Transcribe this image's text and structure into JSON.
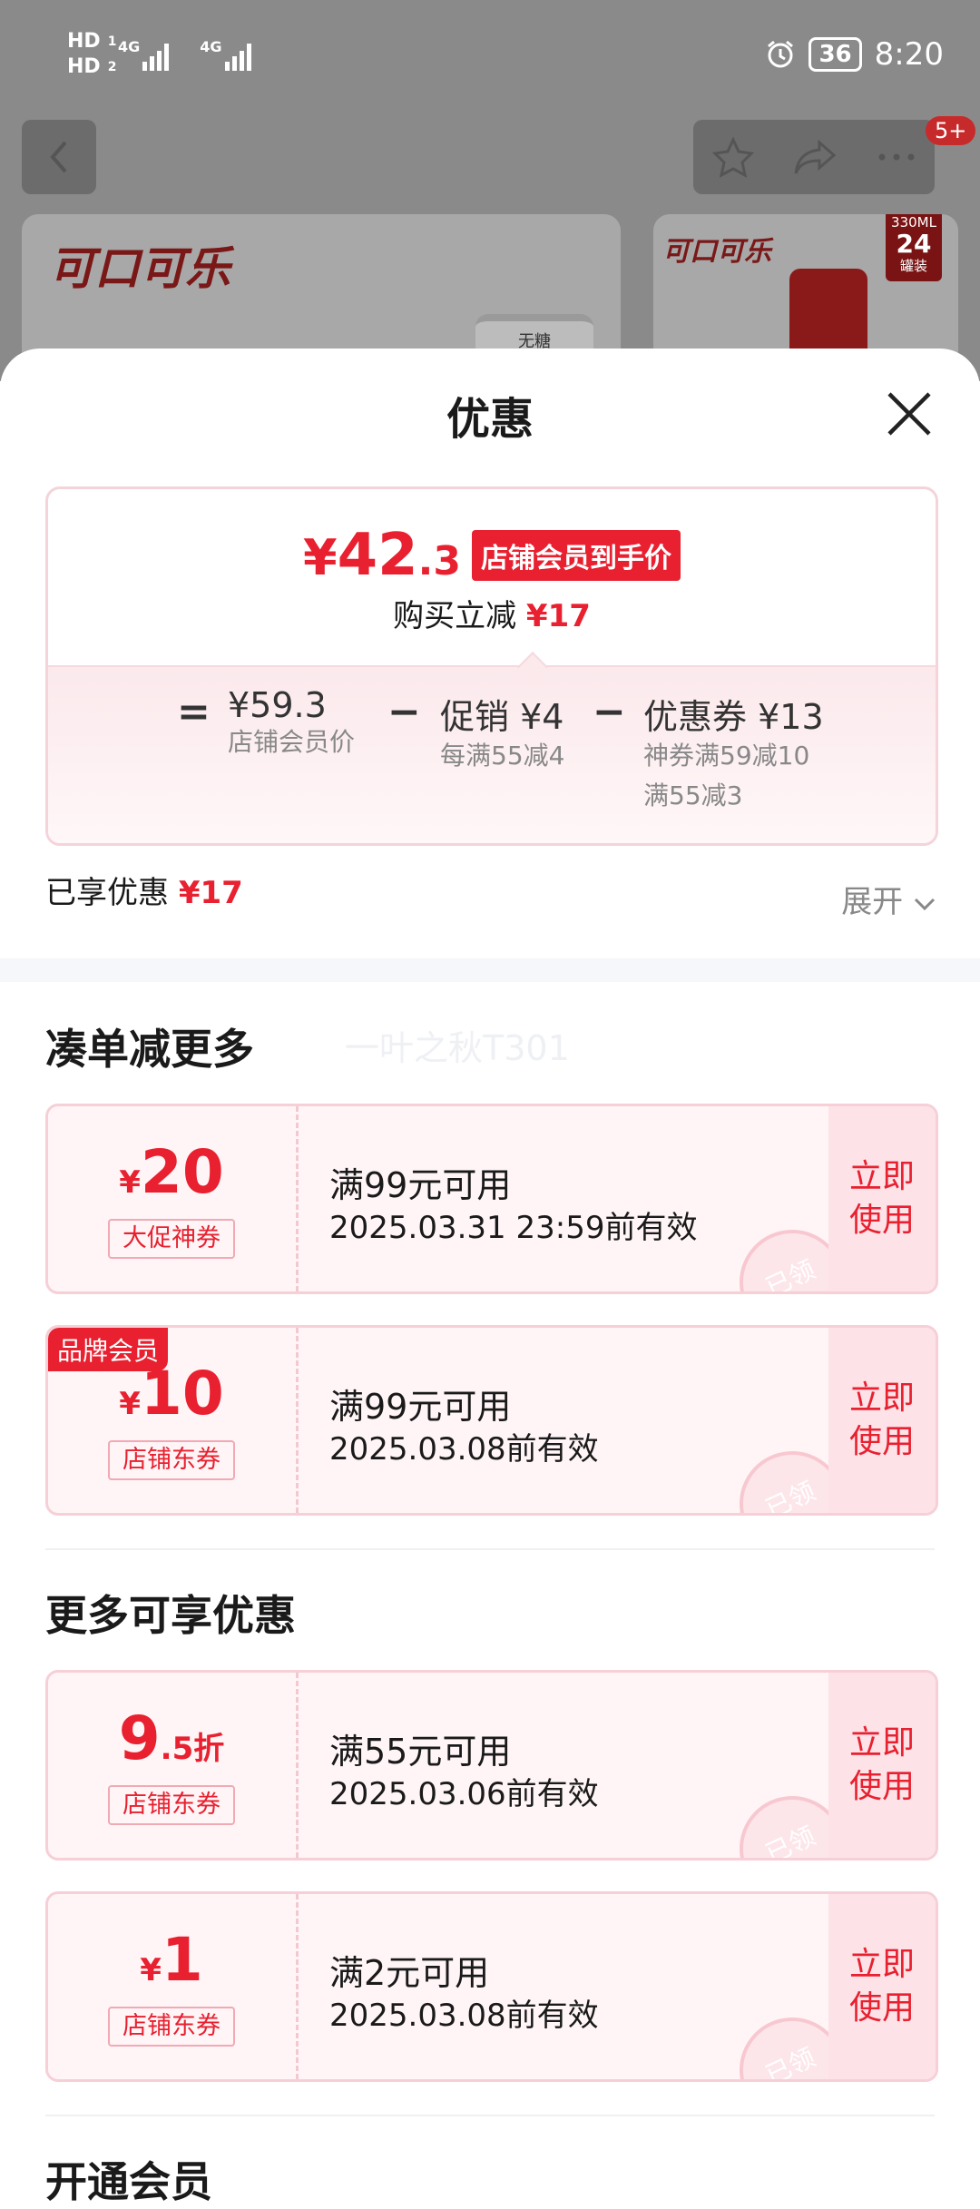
{
  "status_bar": {
    "time": "8:20",
    "battery": "36",
    "net1": "HD",
    "net2": "HD",
    "signal1": "4G",
    "signal2": "4G",
    "sim1": "1",
    "sim2": "2"
  },
  "top_bar": {
    "badge": "5+"
  },
  "background": {
    "brand_left": "可口可乐",
    "brand_right": "可口可乐",
    "can_label": "无糖",
    "tag_top": "330ML",
    "tag_num": "24",
    "tag_bottom": "罐装"
  },
  "sheet": {
    "title": "优惠"
  },
  "price": {
    "yen": "¥",
    "int": "42",
    "dec": ".3",
    "member_tag": "店铺会员到手价",
    "reduce_label": "购买立减",
    "reduce_value": "¥17",
    "eq": "=",
    "minus1": "−",
    "minus2": "−",
    "member_price": "¥59.3",
    "member_price_label": "店铺会员价",
    "promo_label": "促销",
    "promo_value": "¥4",
    "promo_desc": "每满55减4",
    "coupon_label": "优惠券",
    "coupon_value": "¥13",
    "coupon_desc1": "神券满59减10",
    "coupon_desc2": "满55减3"
  },
  "saved": {
    "label": "已享优惠",
    "value": "¥17",
    "expand": "展开"
  },
  "sections": {
    "more_order": "凑单减更多",
    "more_offers": "更多可享优惠",
    "next_partial": "开通会员"
  },
  "watermark": "一叶之秋T301",
  "coupons": [
    {
      "yen": "¥",
      "amount": "20",
      "unit": "",
      "type": "大促神券",
      "condition": "满99元可用",
      "date": "2025.03.31 23:59前有效",
      "use": "立即使用",
      "stamp": "已领",
      "tag": ""
    },
    {
      "yen": "¥",
      "amount": "10",
      "unit": "",
      "type": "店铺东券",
      "condition": "满99元可用",
      "date": "2025.03.08前有效",
      "use": "立即使用",
      "stamp": "已领",
      "tag": "品牌会员"
    },
    {
      "yen": "",
      "amount": "9",
      "unit": ".5折",
      "type": "店铺东券",
      "condition": "满55元可用",
      "date": "2025.03.06前有效",
      "use": "立即使用",
      "stamp": "已领",
      "tag": ""
    },
    {
      "yen": "¥",
      "amount": "1",
      "unit": "",
      "type": "店铺东券",
      "condition": "满2元可用",
      "date": "2025.03.08前有效",
      "use": "立即使用",
      "stamp": "已领",
      "tag": ""
    }
  ],
  "colors": {
    "accent": "#e8202f",
    "coupon_bg": "#fff5f7",
    "coupon_border": "#f6cfd7"
  }
}
